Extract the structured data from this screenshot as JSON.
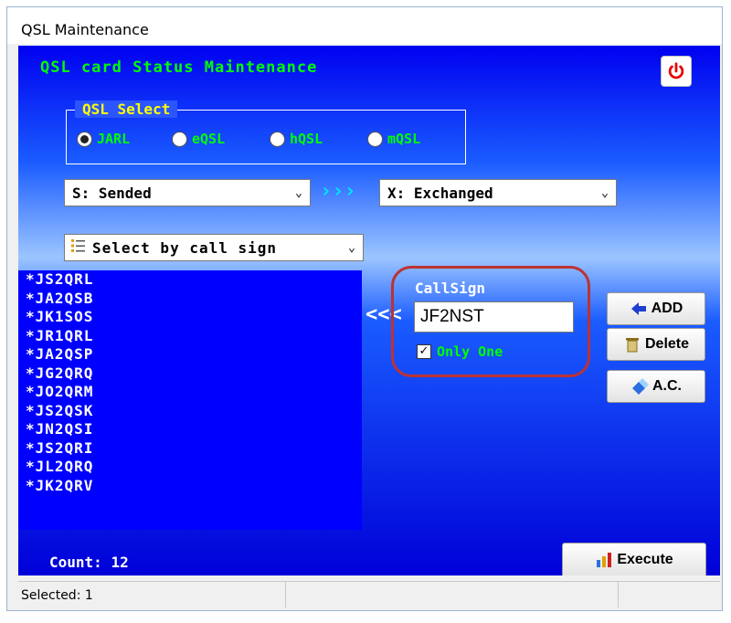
{
  "window": {
    "title": "QSL Maintenance"
  },
  "heading": "QSL card Status Maintenance",
  "qsl_select": {
    "label": "QSL Select",
    "options": [
      {
        "label": "JARL",
        "selected": true
      },
      {
        "label": "eQSL",
        "selected": false
      },
      {
        "label": "hQSL",
        "selected": false
      },
      {
        "label": "mQSL",
        "selected": false
      }
    ]
  },
  "status_from": "S: Sended",
  "arrow_forward": "›››",
  "status_to": "X: Exchanged",
  "filter_mode": "Select by call sign",
  "call_list": [
    "*JS2QRL",
    "*JA2QSB",
    "*JK1SOS",
    "*JR1QRL",
    "*JA2QSP",
    "*JG2QRQ",
    "*JO2QRM",
    "*JS2QSK",
    "*JN2QSI",
    "*JS2QRI",
    "*JL2QRQ",
    "*JK2QRV"
  ],
  "arrow_back": "<<<",
  "callsign": {
    "label": "CallSign",
    "value": "JF2NST",
    "only_one_label": "Only One",
    "only_one_checked": true
  },
  "buttons": {
    "add": "ADD",
    "delete": "Delete",
    "ac": "A.C.",
    "execute": "Execute"
  },
  "count": {
    "label": "Count:",
    "value": "12"
  },
  "status_bar": {
    "text": "Selected: 1"
  },
  "colors": {
    "accent_green": "#00ff00",
    "group_yellow": "#ffff00",
    "list_blue": "#0000ff",
    "power_red": "#e60000"
  }
}
